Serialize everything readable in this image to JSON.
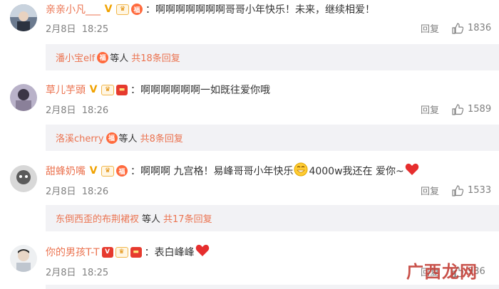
{
  "comments": [
    {
      "username": "亲亲小凡___",
      "text": "：啊啊啊啊啊啊啊哥哥小年快乐！未来，继续相爱！",
      "date": "2月8日",
      "time": "18:25",
      "reply_label": "回复",
      "likes": "1836",
      "thread": {
        "users": "潘小宝elf",
        "etc": "等人",
        "count": "共18条回复"
      }
    },
    {
      "username": "草儿芋頭",
      "text": "：啊啊啊啊啊啊一如既往爱你哦",
      "date": "2月8日",
      "time": "18:26",
      "reply_label": "回复",
      "likes": "1589",
      "thread": {
        "users": "洛溪cherry",
        "etc": "等人",
        "count": "共8条回复"
      }
    },
    {
      "username": "甜蜂奶嘴",
      "text_a": "：啊啊啊 九宫格！易峰哥哥小年快乐",
      "text_b": "4000w我还在 爱你~",
      "date": "2月8日",
      "time": "18:26",
      "reply_label": "回复",
      "likes": "1533",
      "thread": {
        "users": "东倒西歪的布荆裙衩",
        "etc": "等人",
        "count": "共17条回复"
      }
    },
    {
      "username": "你的男孩T-T",
      "text": "：表白峰峰",
      "date": "2月8日",
      "time": "18:25",
      "reply_label": "回复",
      "likes": "936"
    }
  ],
  "badges": {
    "v": "V",
    "fu": "福",
    "crown": "♛"
  },
  "icons": {
    "like": "thumbs-up-icon",
    "emoji_smile": "grin-emoji",
    "emoji_heart": "red-heart-emoji"
  },
  "colors": {
    "username": "#eb7350",
    "meta": "#808080",
    "reply_bg": "#f2f2f5",
    "heart": "#e62e2e"
  },
  "watermark": "广西龙网"
}
